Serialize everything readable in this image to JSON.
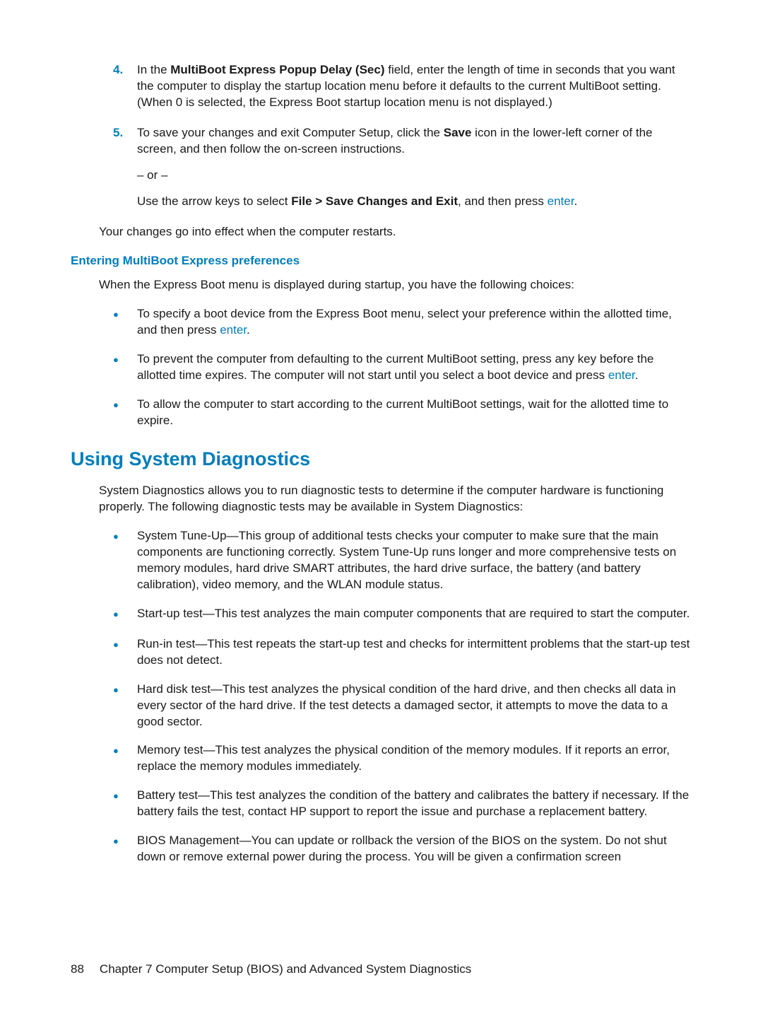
{
  "step4": {
    "num": "4.",
    "pre": "In the ",
    "bold": "MultiBoot Express Popup Delay (Sec)",
    "post": " field, enter the length of time in seconds that you want the computer to display the startup location menu before it defaults to the current MultiBoot setting. (When 0 is selected, the Express Boot startup location menu is not displayed.)"
  },
  "step5": {
    "num": "5.",
    "pre": "To save your changes and exit Computer Setup, click the ",
    "bold": "Save",
    "post": " icon in the lower-left corner of the screen, and then follow the on-screen instructions.",
    "or": "– or –",
    "alt_pre": "Use the arrow keys to select ",
    "alt_bold": "File > Save Changes and Exit",
    "alt_mid": ", and then press ",
    "alt_key": "enter",
    "alt_end": "."
  },
  "restart_note": "Your changes go into effect when the computer restarts.",
  "h4": "Entering MultiBoot Express preferences",
  "express_intro": "When the Express Boot menu is displayed during startup, you have the following choices:",
  "express_items": [
    {
      "pre": "To specify a boot device from the Express Boot menu, select your preference within the allotted time, and then press ",
      "key": "enter",
      "post": "."
    },
    {
      "pre": "To prevent the computer from defaulting to the current MultiBoot setting, press any key before the allotted time expires. The computer will not start until you select a boot device and press ",
      "key": "enter",
      "post": "."
    },
    {
      "pre": "To allow the computer to start according to the current MultiBoot settings, wait for the allotted time to expire.",
      "key": "",
      "post": ""
    }
  ],
  "h2": "Using System Diagnostics",
  "diag_intro": "System Diagnostics allows you to run diagnostic tests to determine if the computer hardware is functioning properly. The following diagnostic tests may be available in System Diagnostics:",
  "diag_items": [
    "System Tune-Up—This group of additional tests checks your computer to make sure that the main components are functioning correctly. System Tune-Up runs longer and more comprehensive tests on memory modules, hard drive SMART attributes, the hard drive surface, the battery (and battery calibration), video memory, and the WLAN module status.",
    "Start-up test—This test analyzes the main computer components that are required to start the computer.",
    "Run-in test—This test repeats the start-up test and checks for intermittent problems that the start-up test does not detect.",
    "Hard disk test—This test analyzes the physical condition of the hard drive, and then checks all data in every sector of the hard drive. If the test detects a damaged sector, it attempts to move the data to a good sector.",
    "Memory test—This test analyzes the physical condition of the memory modules. If it reports an error, replace the memory modules immediately.",
    "Battery test—This test analyzes the condition of the battery and calibrates the battery if necessary. If the battery fails the test, contact HP support to report the issue and purchase a replacement battery.",
    "BIOS Management—You can update or rollback the version of the BIOS on the system. Do not shut down or remove external power during the process. You will be given a confirmation screen"
  ],
  "footer": {
    "page": "88",
    "chapter": "Chapter 7   Computer Setup (BIOS) and Advanced System Diagnostics"
  }
}
